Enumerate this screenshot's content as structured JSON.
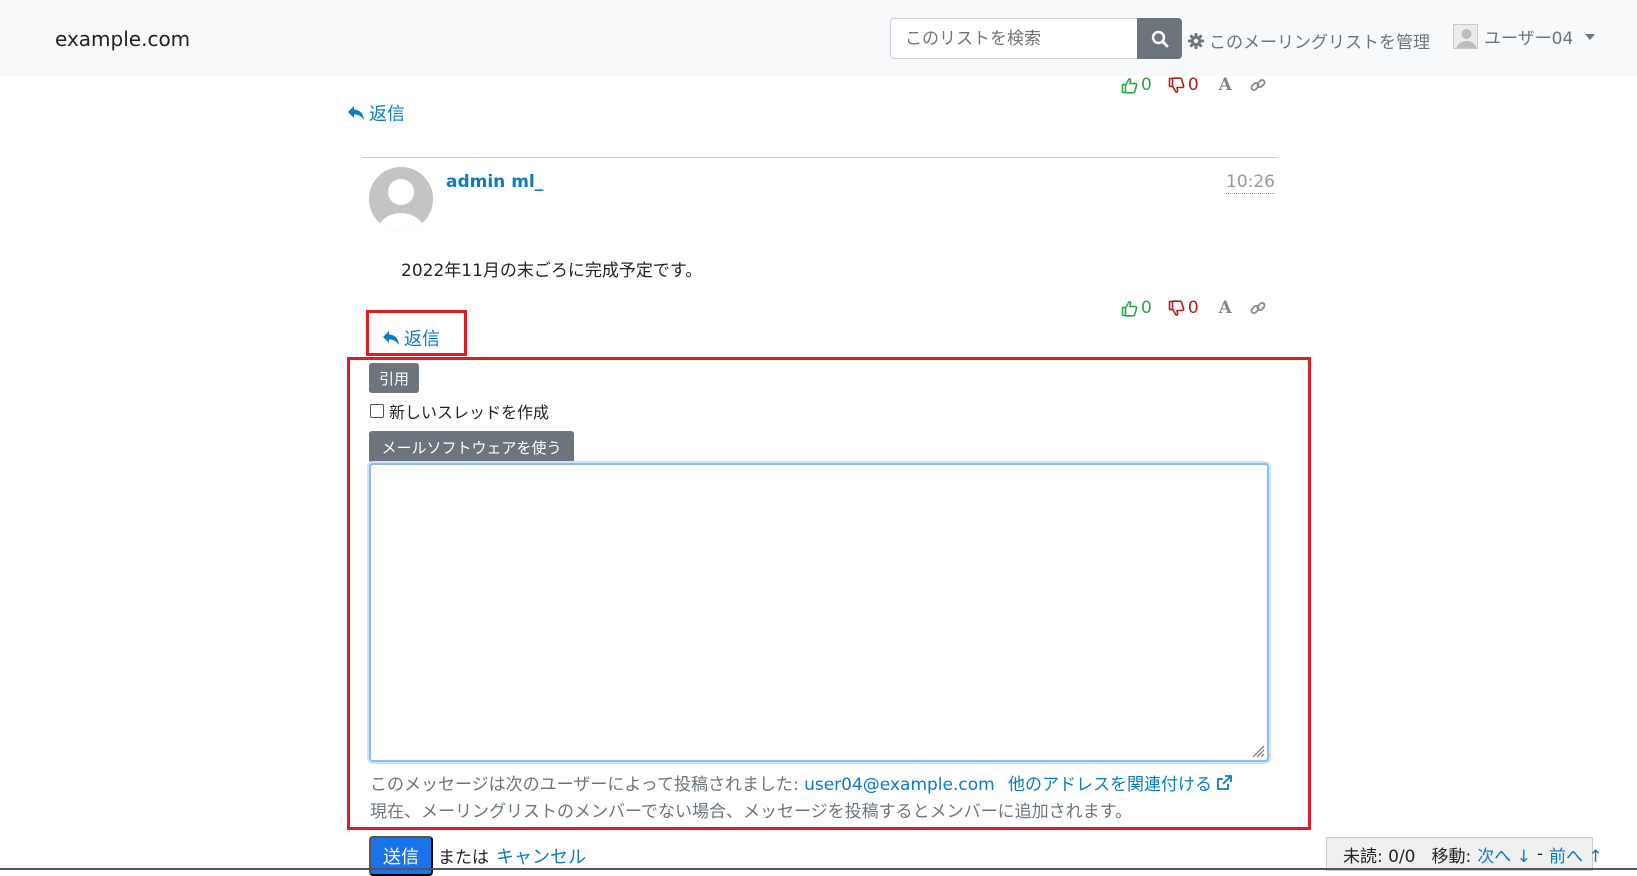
{
  "navbar": {
    "brand": "example.com",
    "search_placeholder": "このリストを検索",
    "manage_label": "このメーリングリストを管理",
    "user_label": "ユーザー04"
  },
  "top_votes": {
    "up": "0",
    "down": "0"
  },
  "reply_top": "返信",
  "message": {
    "author": "admin ml_",
    "time": "10:26",
    "body": "2022年11月の末ごろに完成予定です。",
    "votes": {
      "up": "0",
      "down": "0"
    },
    "reply_label": "返信"
  },
  "reply_form": {
    "quote_label": "引用",
    "new_thread_label": "新しいスレッドを作成",
    "mail_software_label": "メールソフトウェアを使う",
    "posted_by_prefix": "このメッセージは次のユーザーによって投稿されました:",
    "posted_by_email": "user04@example.com",
    "associate_label": "他のアドレスを関連付ける",
    "member_note": "現在、メーリングリストのメンバーでない場合、メッセージを投稿するとメンバーに追加されます。",
    "send_label": "送信",
    "or_label": "または",
    "cancel_label": "キャンセル"
  },
  "status_bar": {
    "unread_label": "未読: 0/0",
    "move_label": "移動:",
    "next_label": "次へ ↓",
    "separator": "-",
    "prev_label": "前へ ↑"
  },
  "colors": {
    "accent": "#0a7cc1",
    "highlight": "#e51b24",
    "upvote": "#28a745",
    "downvote": "#b21e1e"
  }
}
